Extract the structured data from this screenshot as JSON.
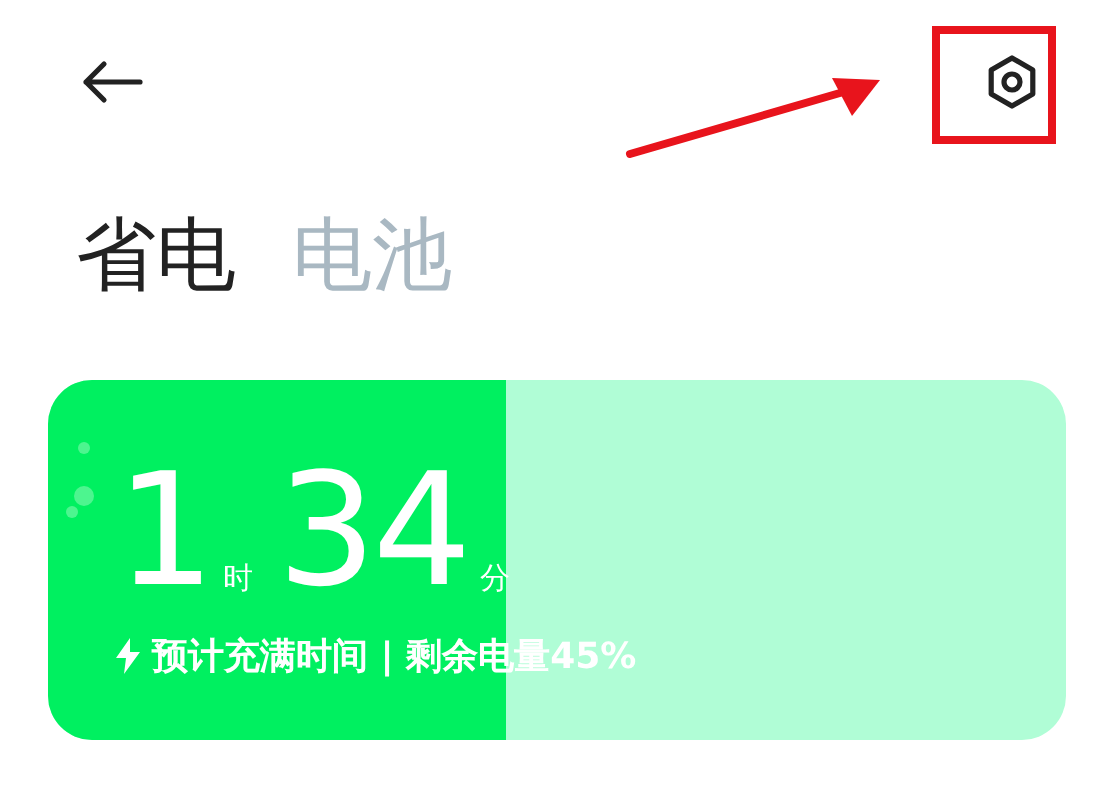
{
  "tabs": [
    {
      "label": "省电",
      "selected": true
    },
    {
      "label": "电池",
      "selected": false
    }
  ],
  "battery": {
    "level": 0.45,
    "hours": "1",
    "hour_unit": "时",
    "minutes": "34",
    "minute_unit": "分",
    "status": "预计充满时间 | 剩余电量45%"
  }
}
